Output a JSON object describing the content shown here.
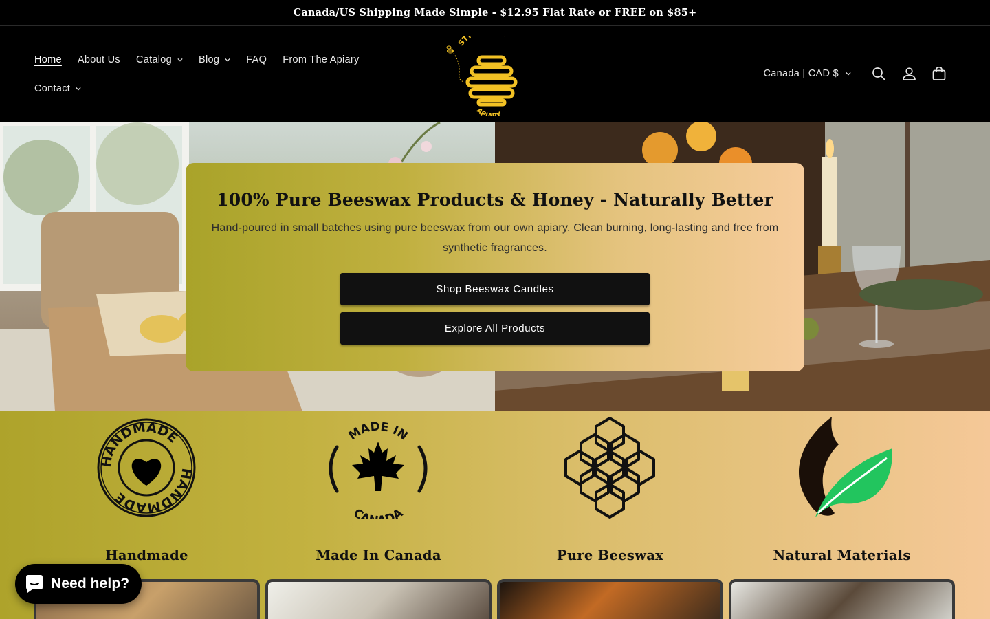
{
  "announcement": {
    "text": "Canada/US Shipping Made Simple - $12.95 Flat Rate or FREE on $85+"
  },
  "nav": {
    "items": [
      {
        "label": "Home",
        "dropdown": false
      },
      {
        "label": "About Us",
        "dropdown": false
      },
      {
        "label": "Catalog",
        "dropdown": true
      },
      {
        "label": "Blog",
        "dropdown": true
      },
      {
        "label": "FAQ",
        "dropdown": false
      },
      {
        "label": "From The Apiary",
        "dropdown": false
      },
      {
        "label": "Contact",
        "dropdown": true
      }
    ]
  },
  "logo": {
    "top_text": "STICKY BEE",
    "bottom_text": "APIARY",
    "accent": "#f2c124"
  },
  "header": {
    "country_selector": "Canada | CAD $",
    "icons": [
      "search-icon",
      "account-icon",
      "cart-icon"
    ]
  },
  "hero": {
    "title": "100% Pure Beeswax Products & Honey - Naturally Better",
    "subtitle": "Hand-poured in small batches using pure beeswax from our own apiary. Clean burning, long-lasting and free from synthetic fragrances.",
    "buttons": [
      "Shop Beeswax Candles",
      "Explore All Products"
    ]
  },
  "features": [
    {
      "title": "Handmade",
      "icon": "handmade-badge-icon",
      "badge_text": "HANDMADE"
    },
    {
      "title": "Made In Canada",
      "icon": "maple-leaf-icon",
      "badge_top": "MADE IN",
      "badge_bottom": "CANADA"
    },
    {
      "title": "Pure Beeswax",
      "icon": "honeycomb-icon"
    },
    {
      "title": "Natural Materials",
      "icon": "leaf-icon"
    }
  ],
  "chat": {
    "label": "Need help?"
  },
  "colors": {
    "brand_black": "#000000",
    "card_gradient_start": "#a9a32a",
    "card_gradient_end": "#f6cc9c",
    "leaf_green": "#22c55e"
  }
}
